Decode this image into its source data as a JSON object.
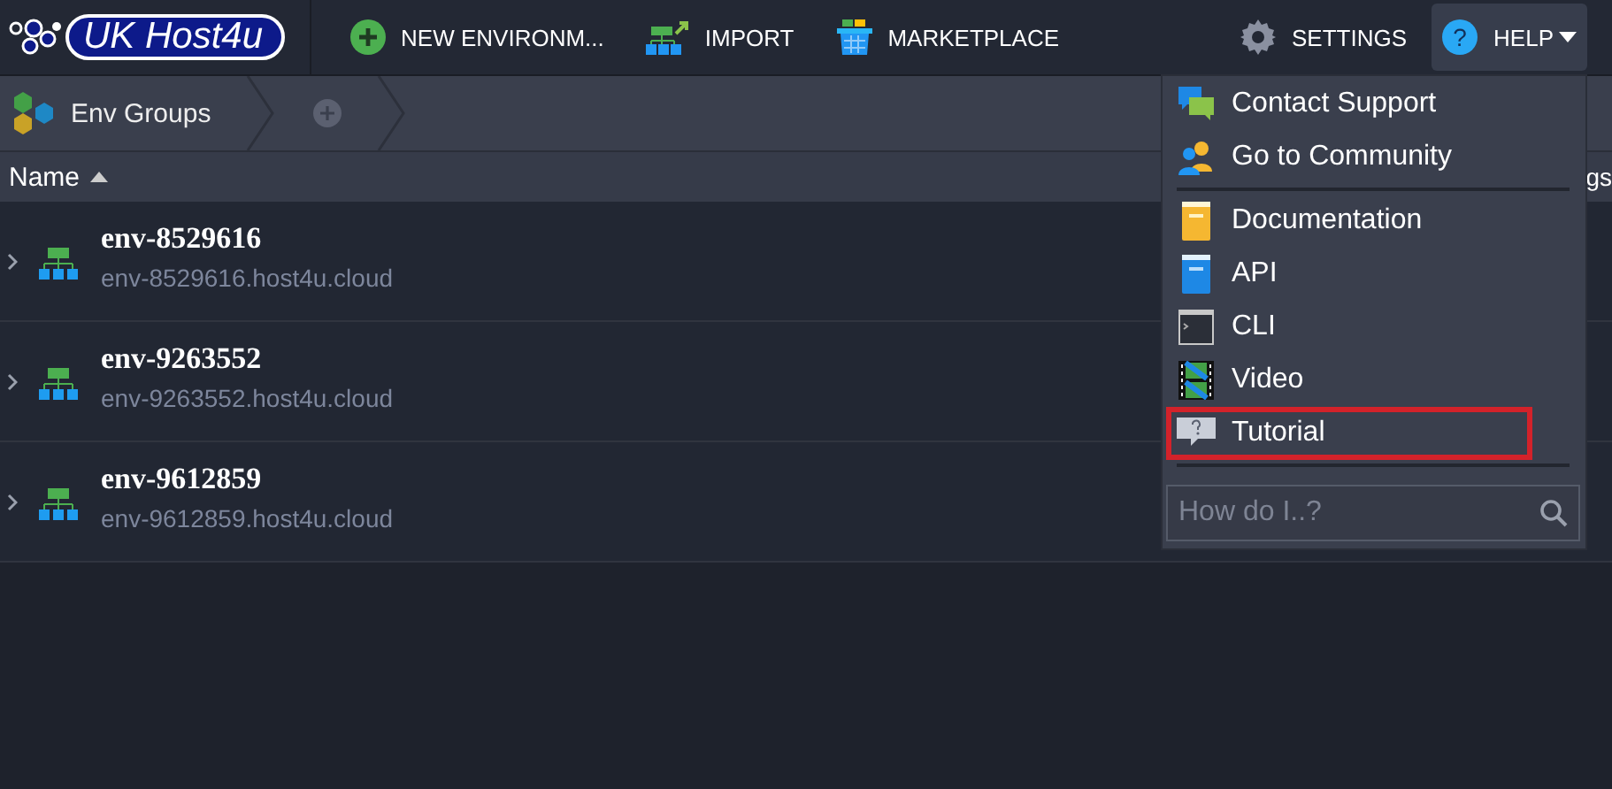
{
  "logo": {
    "text": "UK Host4u"
  },
  "toolbar": [
    {
      "label": "NEW ENVIRONM..."
    },
    {
      "label": "IMPORT"
    },
    {
      "label": "MARKETPLACE"
    }
  ],
  "toolbar_right": [
    {
      "label": "SETTINGS",
      "selected": false
    },
    {
      "label": "HELP",
      "selected": true,
      "icon_text": "?"
    }
  ],
  "breadcrumb": {
    "label": "Env Groups"
  },
  "table": {
    "columns": [
      {
        "label": "Name",
        "sort_ascending": true
      },
      {
        "label": "gs"
      }
    ],
    "rows": [
      {
        "name": "env-8529616",
        "domain": "env-8529616.host4u.cloud"
      },
      {
        "name": "env-9263552",
        "domain": "env-9263552.host4u.cloud"
      },
      {
        "name": "env-9612859",
        "domain": "env-9612859.host4u.cloud"
      }
    ]
  },
  "help_menu": {
    "sections": [
      [
        {
          "label": "Contact Support",
          "highlighted": false
        },
        {
          "label": "Go to Community",
          "highlighted": false
        }
      ],
      [
        {
          "label": "Documentation",
          "highlighted": false
        },
        {
          "label": "API",
          "highlighted": false
        },
        {
          "label": "CLI",
          "highlighted": false
        },
        {
          "label": "Video",
          "highlighted": false
        },
        {
          "label": "Tutorial",
          "highlighted": true
        }
      ]
    ],
    "search": {
      "placeholder": "How do I..?"
    }
  }
}
